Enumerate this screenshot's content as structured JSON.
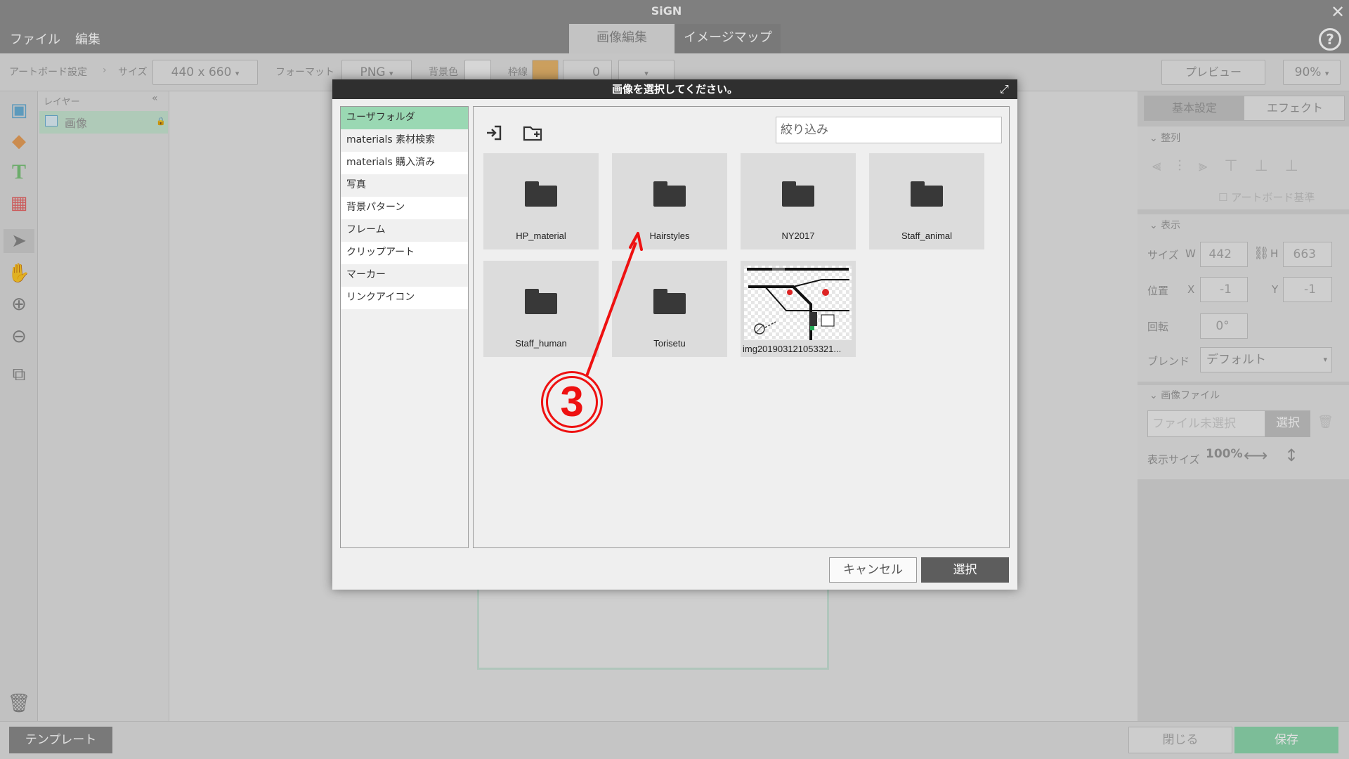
{
  "app": {
    "title": "SiGN",
    "close_glyph": "✕",
    "help_glyph": "?"
  },
  "menubar": {
    "items": [
      "ファイル",
      "編集"
    ]
  },
  "mode_tabs": [
    {
      "label": "画像編集"
    },
    {
      "label": "イメージマップ"
    }
  ],
  "toolbar": {
    "artboard_label": "アートボード設定",
    "size_label": "サイズ",
    "size_value": "440 x 660",
    "format_label": "フォーマット",
    "format_value": "PNG",
    "bg_label": "背景色",
    "border_label": "枠線",
    "border_color": "#e8b56b",
    "border_width": "0",
    "preview_button": "プレビュー",
    "zoom_value": "90%"
  },
  "layers": {
    "header": "レイヤー",
    "collapse_glyph": "«",
    "items": [
      {
        "name": "画像"
      }
    ]
  },
  "right_panel": {
    "tabs": [
      "基本設定",
      "エフェクト"
    ],
    "align_section": "整列",
    "artboard_basis": "アートボード基準",
    "display_section": "表示",
    "size_label": "サイズ",
    "w_label": "W",
    "w_value": "442",
    "h_label": "H",
    "h_value": "663",
    "position_label": "位置",
    "x_label": "X",
    "x_value": "-1",
    "y_label": "Y",
    "y_value": "-1",
    "rotation_label": "回転",
    "rotation_value": "0°",
    "blend_label": "ブレンド",
    "blend_value": "デフォルト",
    "image_file_section": "画像ファイル",
    "file_placeholder": "ファイル未選択",
    "file_select_button": "選択",
    "display_size_label": "表示サイズ",
    "display_size_100": "100%"
  },
  "bottom": {
    "template_button": "テンプレート",
    "close_button": "閉じる",
    "save_button": "保存",
    "save_color": "#8ed8ad"
  },
  "dialog": {
    "title": "画像を選択してください。",
    "sidebar": [
      {
        "label": "ユーザフォルダ",
        "selected": true
      },
      {
        "label": "materials 素材検索"
      },
      {
        "label": "materials 購入済み"
      },
      {
        "label": "写真"
      },
      {
        "label": "背景パターン"
      },
      {
        "label": "フレーム"
      },
      {
        "label": "クリップアート"
      },
      {
        "label": "マーカー"
      },
      {
        "label": "リンクアイコン"
      }
    ],
    "filter_placeholder": "絞り込み",
    "folders": [
      "HP_material",
      "Hairstyles",
      "NY2017",
      "Staff_animal",
      "Staff_human",
      "Torisetu"
    ],
    "image_file": "img201903121053321...",
    "cancel_button": "キャンセル",
    "select_button": "選択"
  },
  "annotation": {
    "number": "3",
    "color": "#ee1111"
  }
}
